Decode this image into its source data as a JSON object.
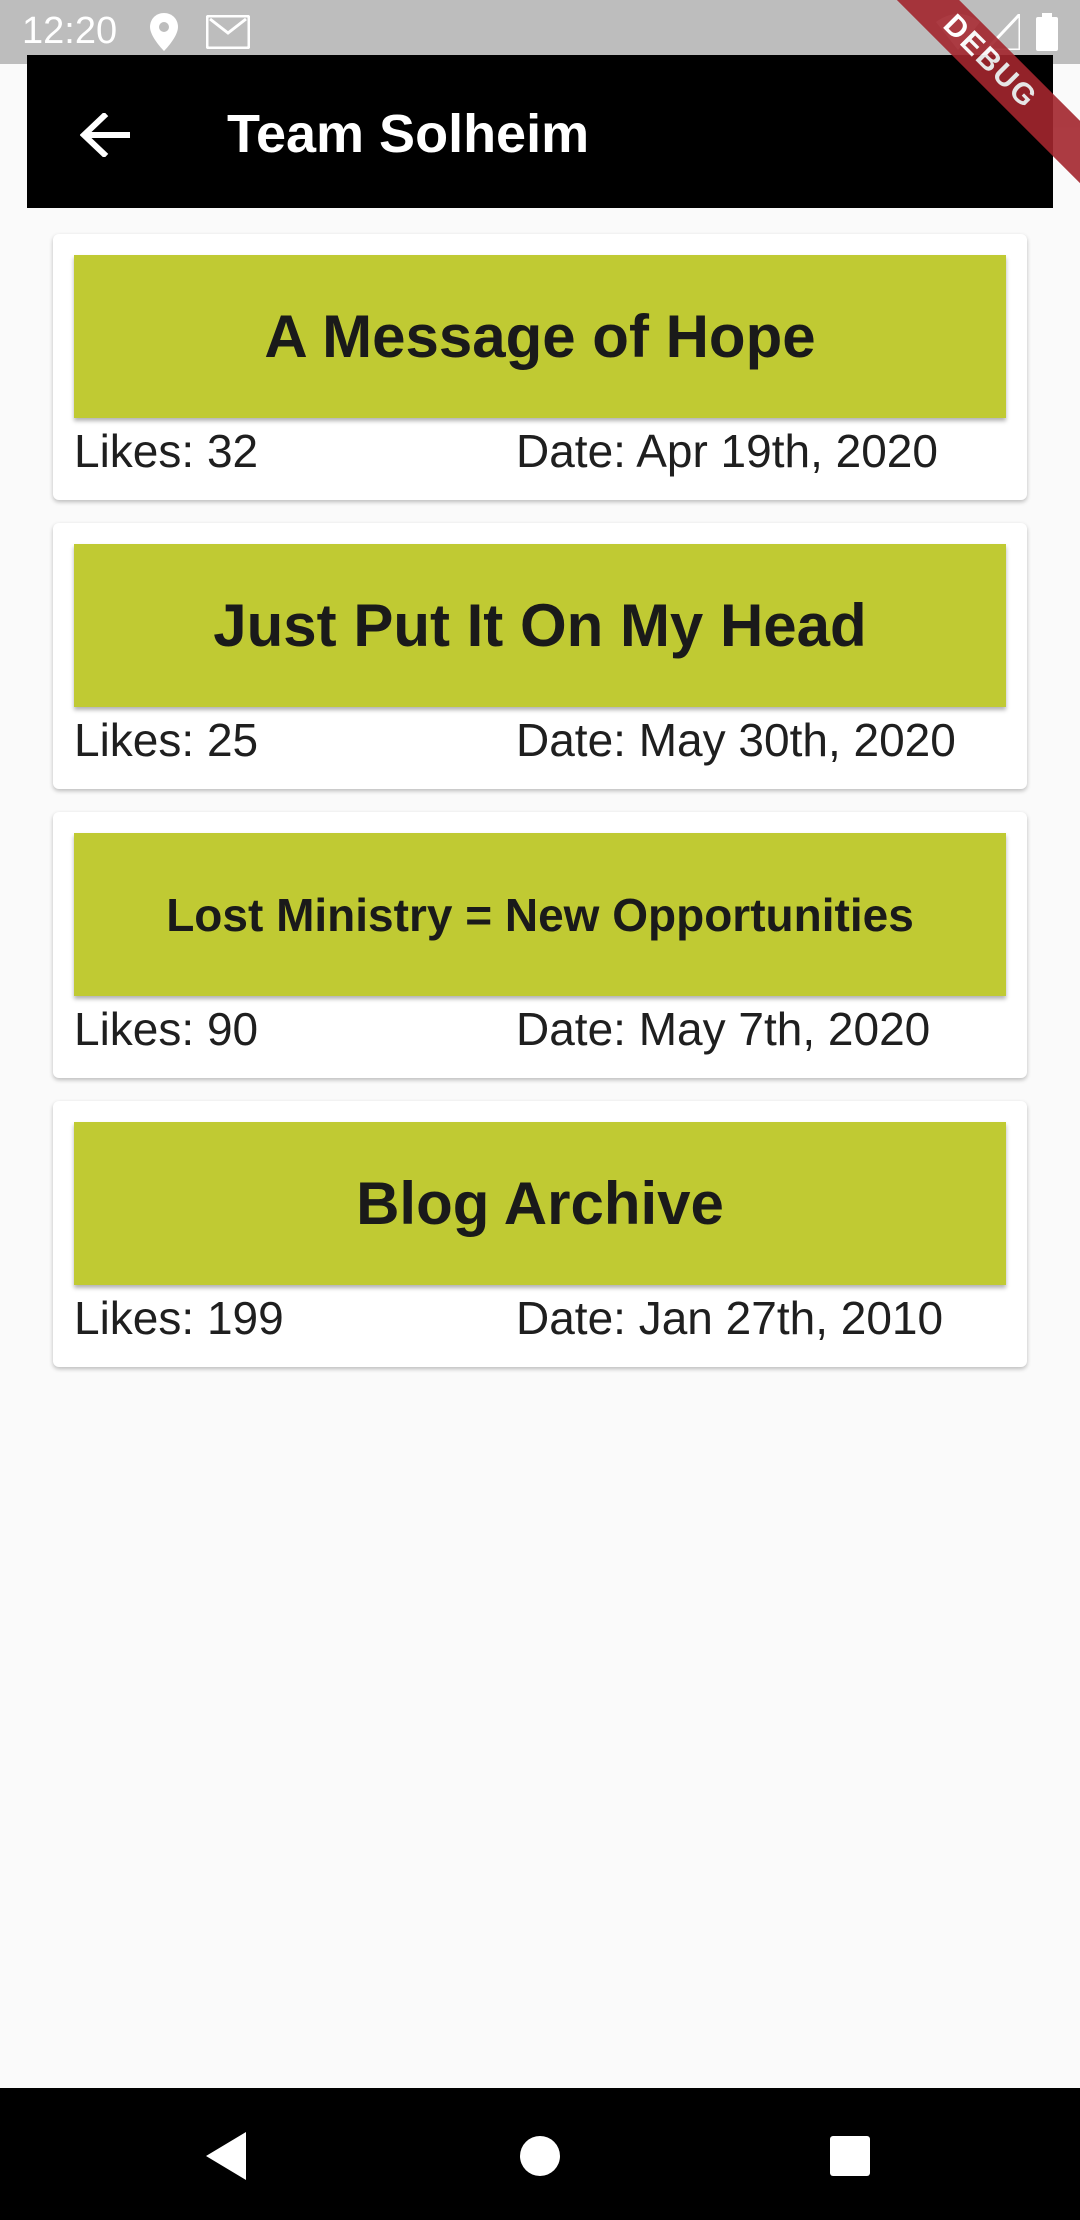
{
  "status_bar": {
    "time": "12:20",
    "icons": [
      "location-icon",
      "gmail-icon",
      "wifi-icon",
      "signal-icon",
      "battery-icon"
    ]
  },
  "app_bar": {
    "title": "Team Solheim",
    "back_icon": "arrow-back-icon"
  },
  "debug_banner": "DEBUG",
  "posts": [
    {
      "title": "A Message of Hope",
      "likes": "Likes: 32",
      "date": "Date: Apr 19th, 2020"
    },
    {
      "title": "Just Put It On My Head",
      "likes": "Likes: 25",
      "date": "Date: May 30th, 2020"
    },
    {
      "title": "Lost Ministry = New Opportunities",
      "likes": "Likes: 90",
      "date": "Date: May 7th, 2020"
    },
    {
      "title": "Blog Archive",
      "likes": "Likes: 199",
      "date": "Date: Jan 27th, 2010"
    }
  ],
  "nav_bar": {
    "icons": [
      "back-triangle-icon",
      "home-circle-icon",
      "recents-square-icon"
    ]
  },
  "colors": {
    "card_banner": "#c0ca33",
    "app_bar": "#000000",
    "status_bar": "#bdbdbd",
    "background": "#fafafa",
    "debug_ribbon": "#a3262e"
  }
}
